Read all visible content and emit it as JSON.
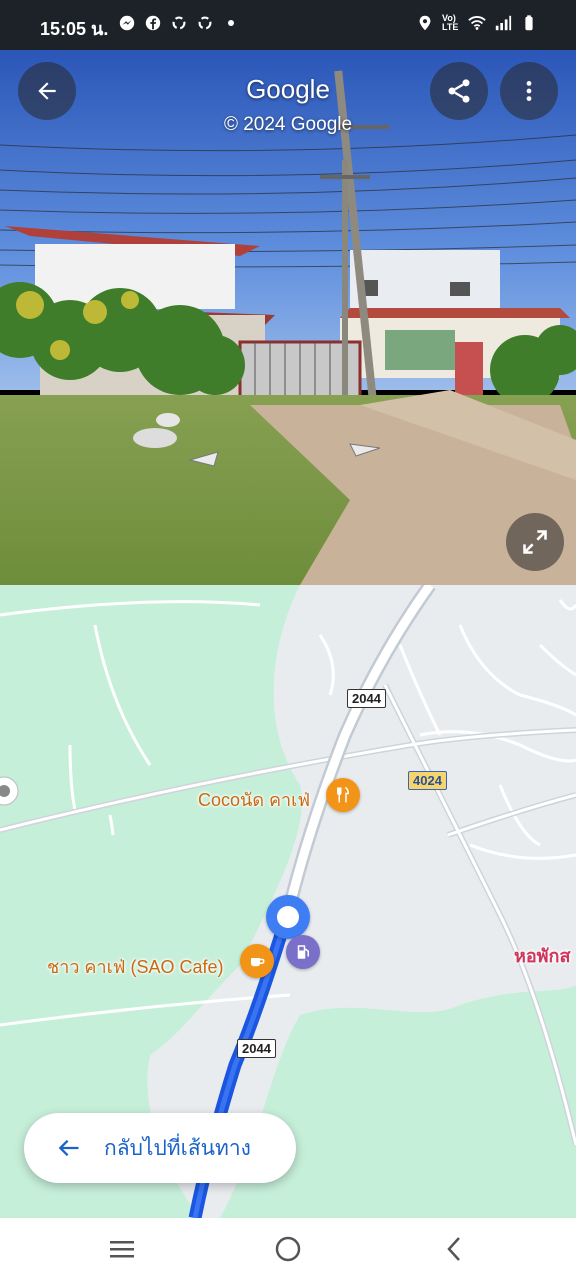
{
  "status_bar": {
    "time": "15:05 น.",
    "left_icons": [
      "messenger-icon",
      "facebook-icon",
      "sync-icon",
      "sync-icon",
      "dot"
    ],
    "right_icons": [
      "location-icon",
      "volte-icon",
      "wifi-icon",
      "signal-icon",
      "battery-icon"
    ],
    "volte_text": "Vo) LTE"
  },
  "street_view": {
    "title": "Google",
    "copyright": "© 2024 Google",
    "buttons": {
      "back": "back-arrow-icon",
      "share": "share-icon",
      "more": "more-vert-icon",
      "expand": "expand-icon"
    }
  },
  "map": {
    "routes": {
      "r2044_top": "2044",
      "r4024": "4024",
      "r2044_bottom": "2044"
    },
    "pois": {
      "coconut_cafe": "Cocoนัด คาเฟ่",
      "sao_cafe": "ชาว คาเฟ่ (SAO Cafe)",
      "dorm": "หอพักส"
    },
    "back_to_route": "กลับไปที่เส้นทาง",
    "colors": {
      "route_blue": "#1a56e0",
      "green_area": "#c6efd9",
      "cafe_orange": "#f29418",
      "gas_purple": "#7a6fc9",
      "location_blue": "#3d7ef5"
    }
  },
  "nav_bar": {
    "items": [
      "recents-icon",
      "home-icon",
      "back-icon"
    ]
  }
}
